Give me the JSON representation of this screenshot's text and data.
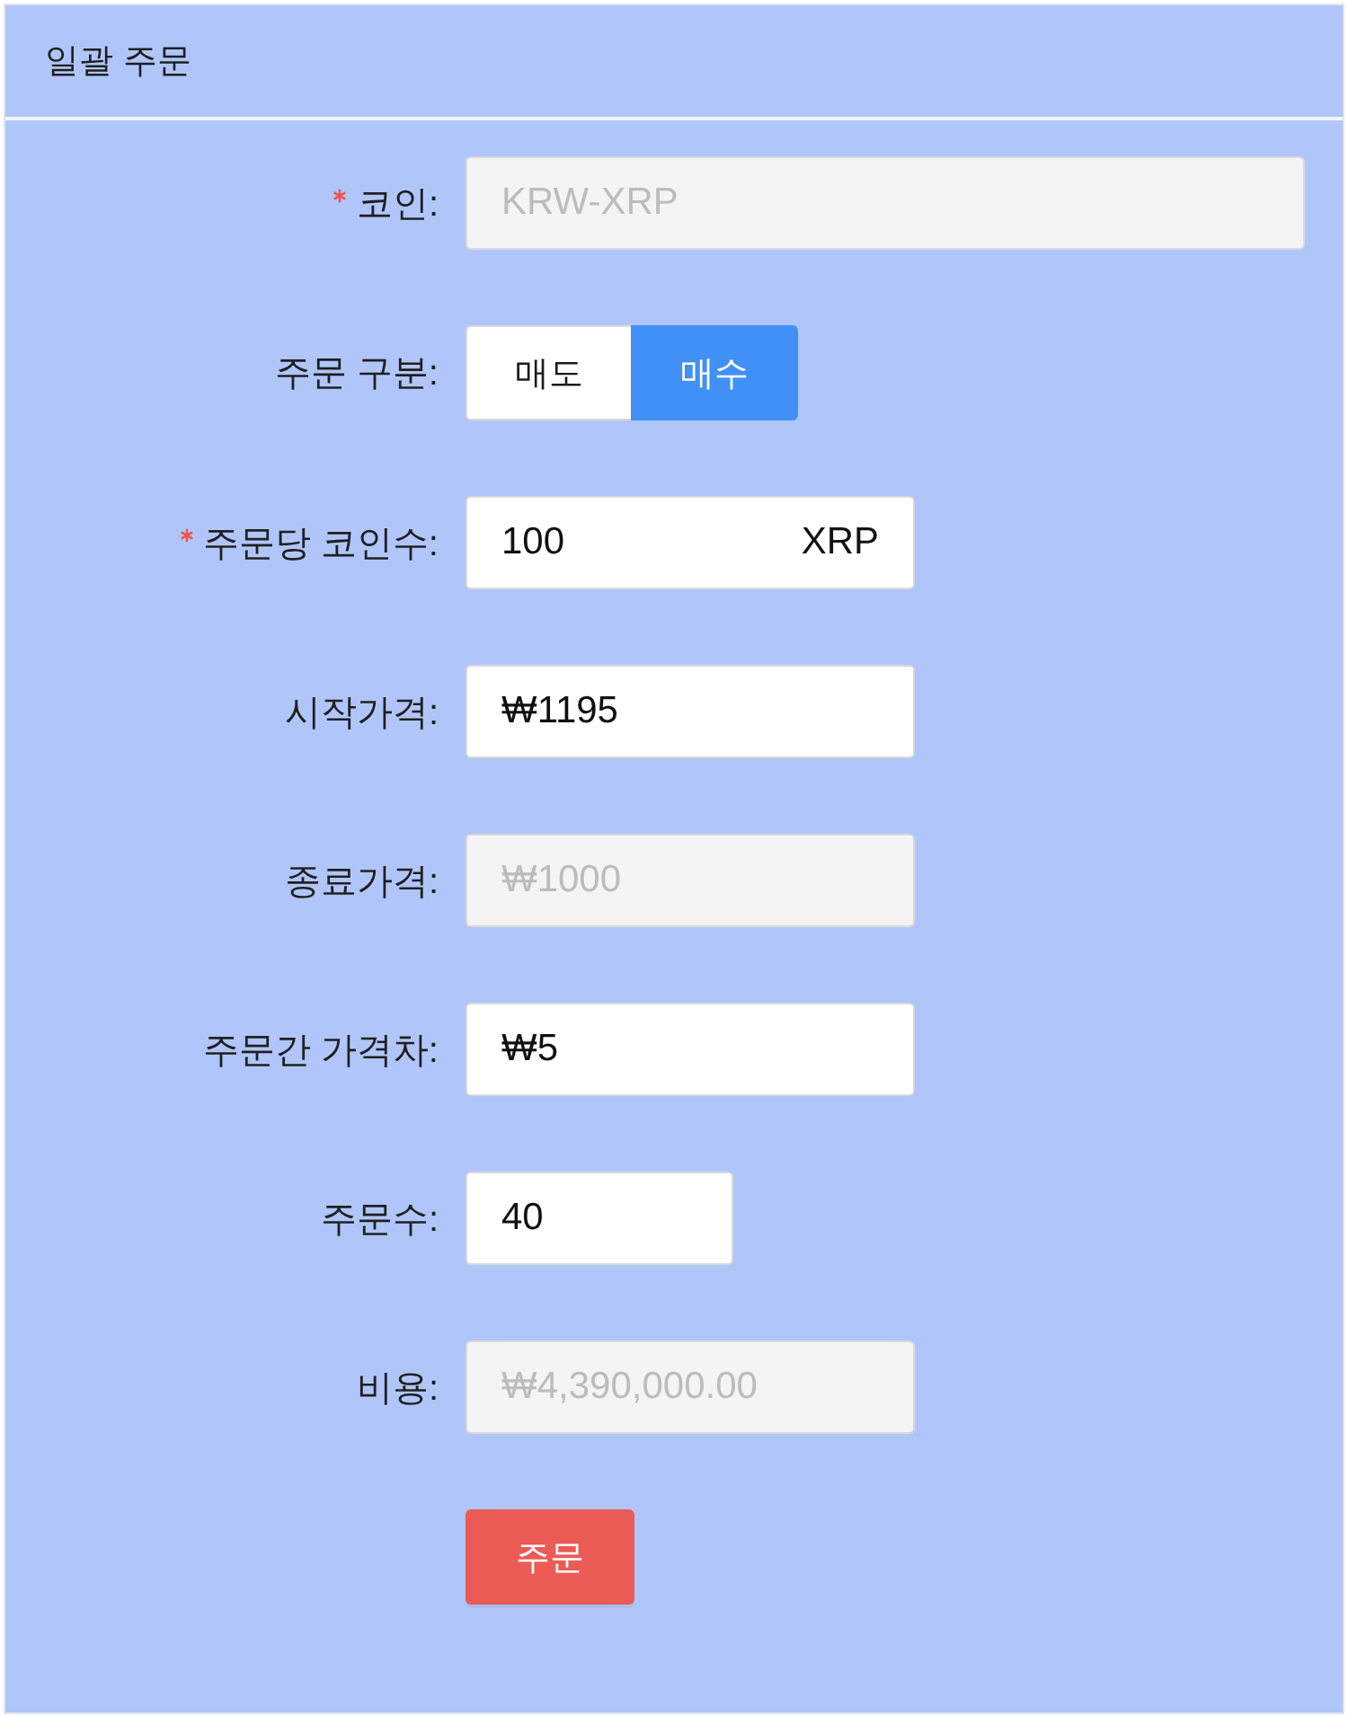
{
  "panel": {
    "title": "일괄 주문"
  },
  "fields": [
    {
      "kind": "text",
      "label": "코인:",
      "required": true,
      "disabled": true,
      "value": "KRW-XRP"
    },
    {
      "kind": "segmented",
      "label": "주문 구분:",
      "required": false,
      "options": [
        {
          "label": "매도",
          "selected": false
        },
        {
          "label": "매수",
          "selected": true
        }
      ]
    },
    {
      "kind": "amount",
      "label": "주문당 코인수:",
      "required": true,
      "disabled": false,
      "value": "100",
      "suffix": "XRP"
    },
    {
      "kind": "price",
      "label": "시작가격:",
      "required": false,
      "disabled": false,
      "value": "₩1195"
    },
    {
      "kind": "price",
      "label": "종료가격:",
      "required": false,
      "disabled": true,
      "value": "₩1000"
    },
    {
      "kind": "price",
      "label": "주문간 가격차:",
      "required": false,
      "disabled": false,
      "value": "₩5"
    },
    {
      "kind": "number",
      "label": "주문수:",
      "required": false,
      "disabled": false,
      "value": "40"
    },
    {
      "kind": "price",
      "label": "비용:",
      "required": false,
      "disabled": true,
      "value": "₩4,390,000.00"
    }
  ],
  "submit": {
    "label": "주문"
  }
}
